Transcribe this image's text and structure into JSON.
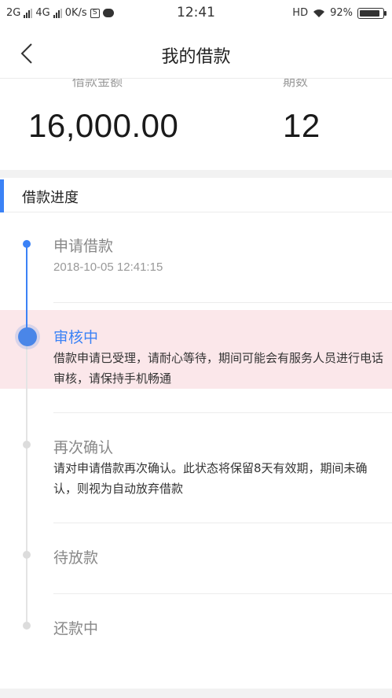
{
  "status_bar": {
    "net1": "2G",
    "net2": "4G",
    "speed": "0K/s",
    "s_icon": "S",
    "time": "12:41",
    "hd": "HD",
    "battery": "92%",
    "battery_level": 0.92
  },
  "nav": {
    "title": "我的借款"
  },
  "summary": {
    "amount_label": "借款金额",
    "amount": "16,000.00",
    "term_label": "期数",
    "term": "12"
  },
  "section": {
    "title": "借款进度"
  },
  "timeline": {
    "steps": [
      {
        "title": "申请借款",
        "time": "2018-10-05 12:41:15",
        "state": "done"
      },
      {
        "title": "审核中",
        "desc": "借款申请已受理，请耐心等待，期间可能会有服务人员进行电话审核，请保持手机畅通",
        "state": "current"
      },
      {
        "title": "再次确认",
        "desc": "请对申请借款再次确认。此状态将保留8天有效期，期间未确认，则视为自动放弃借款",
        "state": "pending"
      },
      {
        "title": "待放款",
        "state": "pending"
      },
      {
        "title": "还款中",
        "state": "pending"
      }
    ]
  },
  "colors": {
    "accent": "#3b82f6",
    "highlight": "#fbe7ea",
    "pending_dot": "#dcdcdc"
  }
}
